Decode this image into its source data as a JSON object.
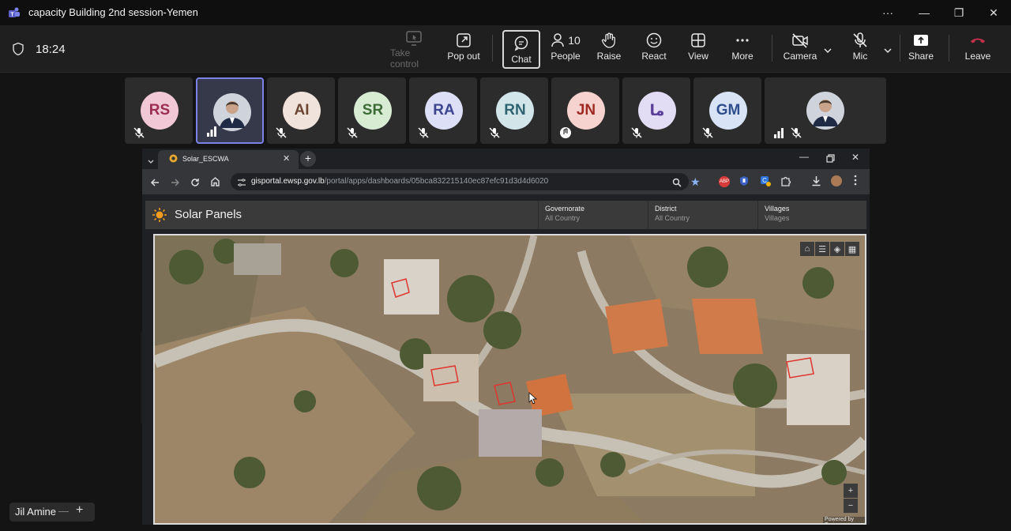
{
  "window": {
    "title": "capacity Building 2nd session-Yemen",
    "more_label": "···",
    "minimize_label": "—",
    "maximize_label": "❐",
    "close_label": "✕"
  },
  "meeting": {
    "timer": "18:24"
  },
  "toolbar": {
    "take_control": "Take control",
    "pop_out": "Pop out",
    "chat": "Chat",
    "people": "People",
    "people_count": "10",
    "raise": "Raise",
    "react": "React",
    "view": "View",
    "more": "More",
    "camera": "Camera",
    "mic": "Mic",
    "share": "Share",
    "leave": "Leave"
  },
  "participants": [
    {
      "initials": "RS",
      "bg": "#f1c9d6",
      "fg": "#9b2d52"
    },
    {
      "initials": "",
      "bg": "#3a4a66",
      "fg": "#fff"
    },
    {
      "initials": "AI",
      "bg": "#efe3dc",
      "fg": "#6b4633"
    },
    {
      "initials": "SR",
      "bg": "#d8ecd4",
      "fg": "#3c6b36"
    },
    {
      "initials": "RA",
      "bg": "#dcdff5",
      "fg": "#3e4590"
    },
    {
      "initials": "RN",
      "bg": "#d2e6ea",
      "fg": "#2f6470"
    },
    {
      "initials": "JN",
      "bg": "#f6d3cf",
      "fg": "#a02a23"
    },
    {
      "initials": "ما",
      "bg": "#e2dcf4",
      "fg": "#5a3f9a"
    },
    {
      "initials": "GM",
      "bg": "#d8e3f6",
      "fg": "#2e4f8c"
    },
    {
      "initials": "",
      "bg": "#3b3b3b",
      "fg": "#fff"
    }
  ],
  "browser": {
    "tab_title": "Solar_ESCWA",
    "url_host": "gisportal.ewsp.gov.lb",
    "url_path": "/portal/apps/dashboards/05bca832215140ec87efc91d3d4d6020"
  },
  "dashboard": {
    "title": "Solar Panels",
    "filters": [
      {
        "label": "Governorate",
        "value": "All Country"
      },
      {
        "label": "District",
        "value": "All Country"
      },
      {
        "label": "Villages",
        "value": "Villages"
      }
    ],
    "attribution": "Powered by Esri",
    "zoom_in": "+",
    "zoom_out": "−"
  },
  "presenter": {
    "name": "Jil Amine"
  },
  "colors": {
    "accent": "#7b83eb",
    "leave": "#c4314b"
  }
}
